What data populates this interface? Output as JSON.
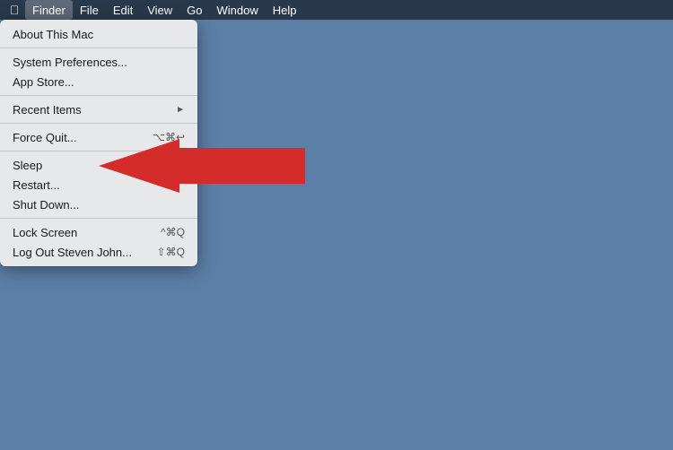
{
  "menubar": {
    "apple_label": "",
    "items": [
      {
        "label": "Finder",
        "active": true
      },
      {
        "label": "File",
        "active": false
      },
      {
        "label": "Edit",
        "active": false
      },
      {
        "label": "View",
        "active": false
      },
      {
        "label": "Go",
        "active": false
      },
      {
        "label": "Window",
        "active": false
      },
      {
        "label": "Help",
        "active": false
      }
    ]
  },
  "dropdown": {
    "items": [
      {
        "id": "about",
        "label": "About This Mac",
        "shortcut": "",
        "arrow": false,
        "separator_after": false
      },
      {
        "id": "sep1",
        "separator": true
      },
      {
        "id": "system_prefs",
        "label": "System Preferences...",
        "shortcut": "",
        "arrow": false,
        "separator_after": false
      },
      {
        "id": "app_store",
        "label": "App Store...",
        "shortcut": "",
        "arrow": false,
        "separator_after": false
      },
      {
        "id": "sep2",
        "separator": true
      },
      {
        "id": "recent_items",
        "label": "Recent Items",
        "shortcut": "",
        "arrow": true,
        "separator_after": false
      },
      {
        "id": "sep3",
        "separator": true
      },
      {
        "id": "force_quit",
        "label": "Force Quit...",
        "shortcut": "⌥⌘↩",
        "arrow": false,
        "separator_after": false
      },
      {
        "id": "sep4",
        "separator": true
      },
      {
        "id": "sleep",
        "label": "Sleep",
        "shortcut": "",
        "arrow": false,
        "separator_after": false
      },
      {
        "id": "restart",
        "label": "Restart...",
        "shortcut": "",
        "arrow": false,
        "separator_after": false
      },
      {
        "id": "shutdown",
        "label": "Shut Down...",
        "shortcut": "",
        "arrow": false,
        "separator_after": false
      },
      {
        "id": "sep5",
        "separator": true
      },
      {
        "id": "lock_screen",
        "label": "Lock Screen",
        "shortcut": "^⌘Q",
        "arrow": false,
        "separator_after": false
      },
      {
        "id": "logout",
        "label": "Log Out Steven John...",
        "shortcut": "⇧⌘Q",
        "arrow": false,
        "separator_after": false
      }
    ]
  }
}
